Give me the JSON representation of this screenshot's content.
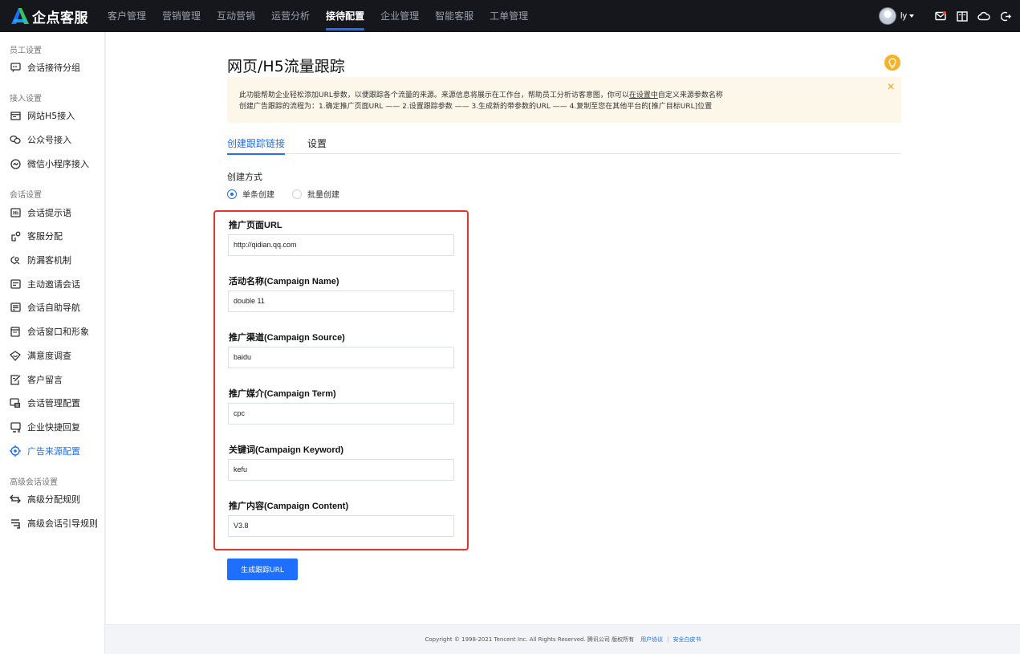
{
  "brand": {
    "name": "企点客服"
  },
  "topnav": {
    "items": [
      {
        "label": "客户管理",
        "active": false
      },
      {
        "label": "营销管理",
        "active": false
      },
      {
        "label": "互动营销",
        "active": false
      },
      {
        "label": "运营分析",
        "active": false
      },
      {
        "label": "接待配置",
        "active": true
      },
      {
        "label": "企业管理",
        "active": false
      },
      {
        "label": "智能客服",
        "active": false
      },
      {
        "label": "工单管理",
        "active": false
      }
    ],
    "user": "ly"
  },
  "sidebar": {
    "groups": [
      {
        "title": "员工设置",
        "items": [
          {
            "label": "会话接待分组",
            "icon": "chat-group-icon"
          }
        ]
      },
      {
        "title": "接入设置",
        "items": [
          {
            "label": "网站H5接入",
            "icon": "website-icon"
          },
          {
            "label": "公众号接入",
            "icon": "wechat-icon"
          },
          {
            "label": "微信小程序接入",
            "icon": "mini-program-icon"
          }
        ]
      },
      {
        "title": "会话设置",
        "items": [
          {
            "label": "会话提示语",
            "icon": "hint-icon"
          },
          {
            "label": "客服分配",
            "icon": "assign-icon"
          },
          {
            "label": "防漏客机制",
            "icon": "guard-icon"
          },
          {
            "label": "主动邀请会话",
            "icon": "invite-icon"
          },
          {
            "label": "会话自助导航",
            "icon": "navigation-icon"
          },
          {
            "label": "会话窗口和形象",
            "icon": "window-icon"
          },
          {
            "label": "满意度调查",
            "icon": "survey-icon"
          },
          {
            "label": "客户留言",
            "icon": "message-icon"
          },
          {
            "label": "会话管理配置",
            "icon": "manage-icon"
          },
          {
            "label": "企业快捷回复",
            "icon": "quick-reply-icon"
          },
          {
            "label": "广告来源配置",
            "icon": "ad-source-icon",
            "active": true
          }
        ]
      },
      {
        "title": "高级会话设置",
        "items": [
          {
            "label": "高级分配规则",
            "icon": "swap-icon"
          },
          {
            "label": "高级会话引导规则",
            "icon": "guide-icon"
          }
        ]
      }
    ]
  },
  "page": {
    "title": "网页/H5流量跟踪",
    "notice": {
      "line1_a": "此功能帮助企业轻松添加URL参数，以便跟踪各个流量的来源。来源信息将展示在工作台，帮助员工分析访客意图，你可以",
      "line1_link": "在设置中",
      "line1_b": "自定义来源参数名称",
      "line2": "创建广告跟踪的流程为：1.确定推广页面URL —— 2.设置跟踪参数 —— 3.生成新的带参数的URL —— 4.复制至您在其他平台的[推广目标URL]位置"
    },
    "tabs": [
      {
        "label": "创建跟踪链接",
        "active": true
      },
      {
        "label": "设置",
        "active": false
      }
    ],
    "create_mode_label": "创建方式",
    "radios": [
      {
        "label": "单条创建",
        "checked": true
      },
      {
        "label": "批量创建",
        "checked": false
      }
    ],
    "fields": [
      {
        "label": "推广页面URL",
        "value": "http://qidian.qq.com"
      },
      {
        "label": "活动名称(Campaign Name)",
        "value": "double 11"
      },
      {
        "label": "推广渠道(Campaign Source)",
        "value": "baidu"
      },
      {
        "label": "推广媒介(Campaign Term)",
        "value": "cpc"
      },
      {
        "label": "关键词(Campaign Keyword)",
        "value": "kefu"
      },
      {
        "label": "推广内容(Campaign Content)",
        "value": "V3.8"
      }
    ],
    "generate_button": "生成跟踪URL"
  },
  "footer": {
    "copyright": "Copyright © 1998-2021 Tencent Inc. All Rights Reserved. 腾讯公司 版权所有",
    "link1": "用户协议",
    "separator": "|",
    "link2": "安全白皮书"
  },
  "colors": {
    "accent": "#1f6fff",
    "highlight_border": "#e8322a",
    "notice_bg": "#fdf7ea",
    "topbar": "#15171c"
  }
}
